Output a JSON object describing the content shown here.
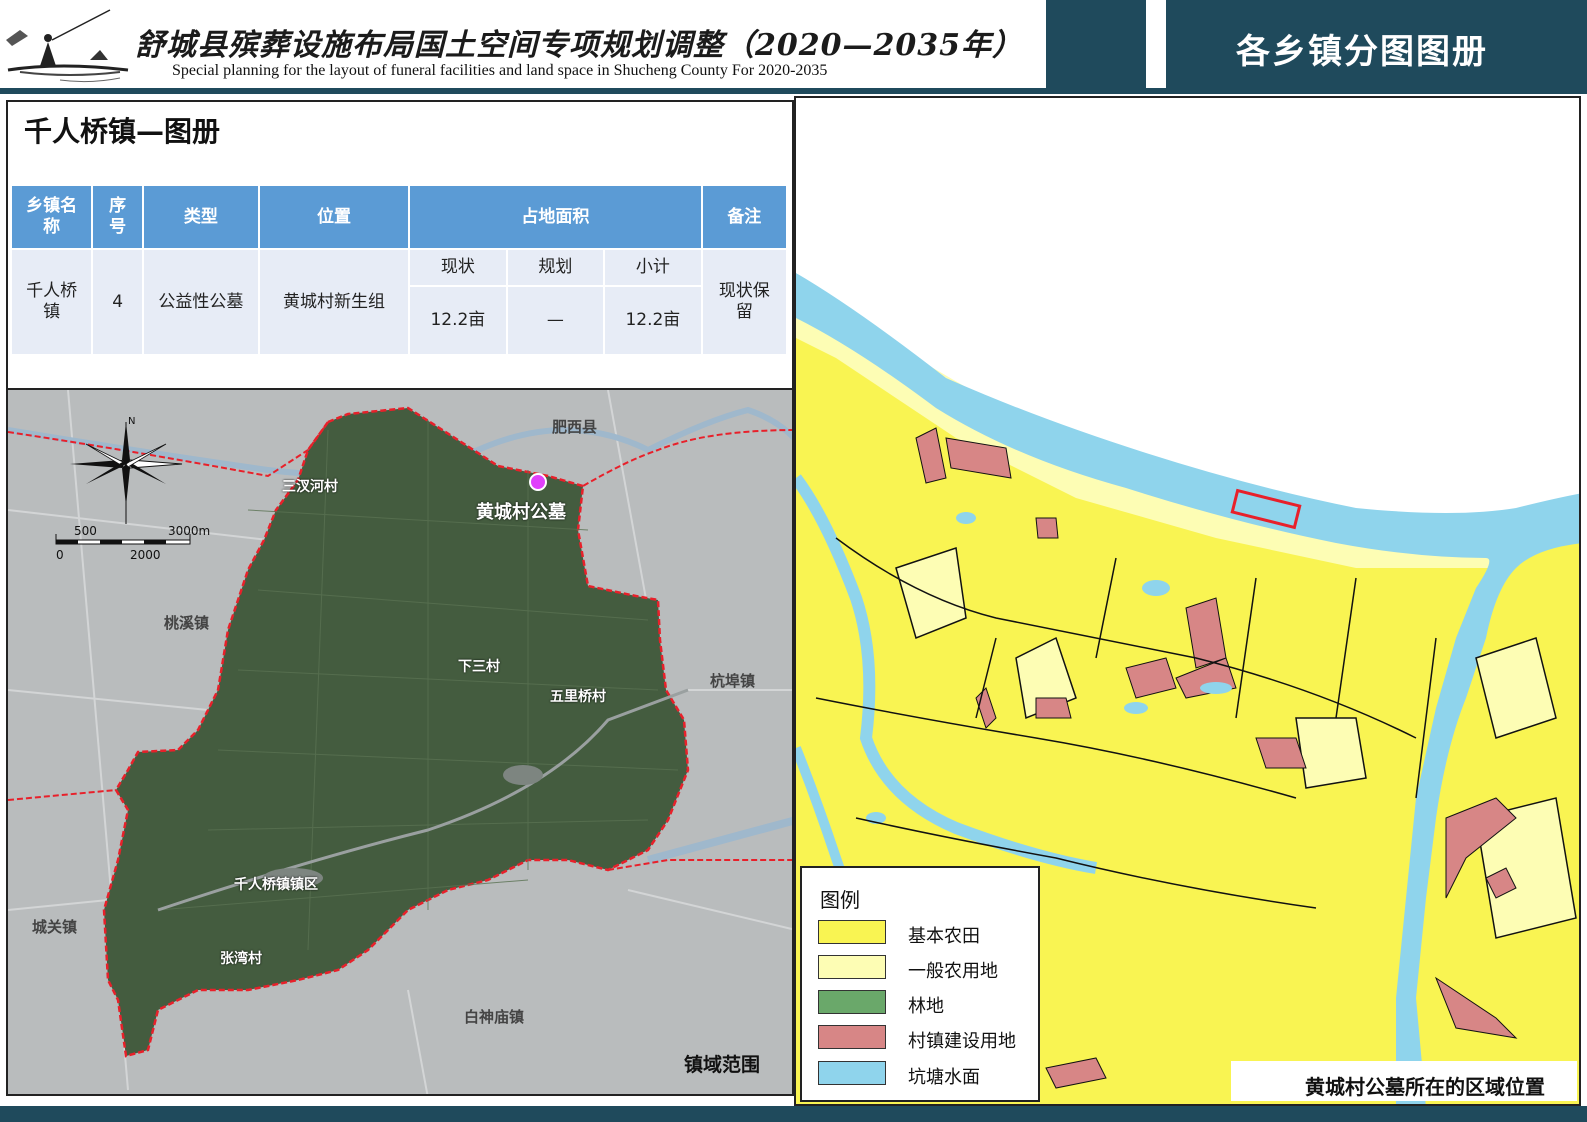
{
  "header": {
    "title_cn": "舒城县殡葬设施布局国土空间专项规划调整（2020—2035年）",
    "title_en": "Special planning for the layout of funeral facilities and land space in Shucheng County For 2020-2035",
    "section_title": "各乡镇分图图册"
  },
  "panel": {
    "title": "千人桥镇—图册"
  },
  "table": {
    "headers": {
      "town": "乡镇名称",
      "seq": "序号",
      "type": "类型",
      "location": "位置",
      "area": "占地面积",
      "note": "备注"
    },
    "sub_headers": {
      "current": "现状",
      "planned": "规划",
      "subtotal": "小计"
    },
    "row": {
      "town": "千人桥镇",
      "seq": "4",
      "type": "公益性公墓",
      "location": "黄城村新生组",
      "current": "12.2亩",
      "planned": "—",
      "subtotal": "12.2亩",
      "note": "现状保留"
    }
  },
  "sat_map": {
    "scale": {
      "label_500": "500",
      "label_3000m": "3000m",
      "label_0": "0",
      "label_2000": "2000"
    },
    "north": "N",
    "villages": {
      "sanchahe": "三汊河村",
      "xiasan": "下三村",
      "wuliqiao": "五里桥村",
      "town_center": "千人桥镇镇区",
      "zhangwan": "张湾村"
    },
    "neighbors": {
      "feixi": "肥西县",
      "taoxi": "桃溪镇",
      "hangbu": "杭埠镇",
      "chengguan": "城关镇",
      "baishenmiao": "白神庙镇"
    },
    "site_label": "黄城村公墓",
    "caption": "镇域范围"
  },
  "legend": {
    "title": "图例",
    "items": [
      {
        "label": "基本农田",
        "color": "#f9f452"
      },
      {
        "label": "一般农用地",
        "color": "#fdfdb4"
      },
      {
        "label": "林地",
        "color": "#6aa86a"
      },
      {
        "label": "村镇建设用地",
        "color": "#d78686"
      },
      {
        "label": "坑塘水面",
        "color": "#8fd4ec"
      }
    ]
  },
  "land_map": {
    "caption": "黄城村公墓所在的区域位置"
  },
  "colors": {
    "header_dark": "#1f4a5c",
    "table_header": "#5b9bd5",
    "table_cell": "#e7ecf6",
    "boundary_red": "#e8202a",
    "site_marker": "#e040fb",
    "basic_farmland": "#f9f452",
    "general_farmland": "#fdfdb4",
    "construction_land": "#d78686",
    "water": "#8fd4ec"
  }
}
